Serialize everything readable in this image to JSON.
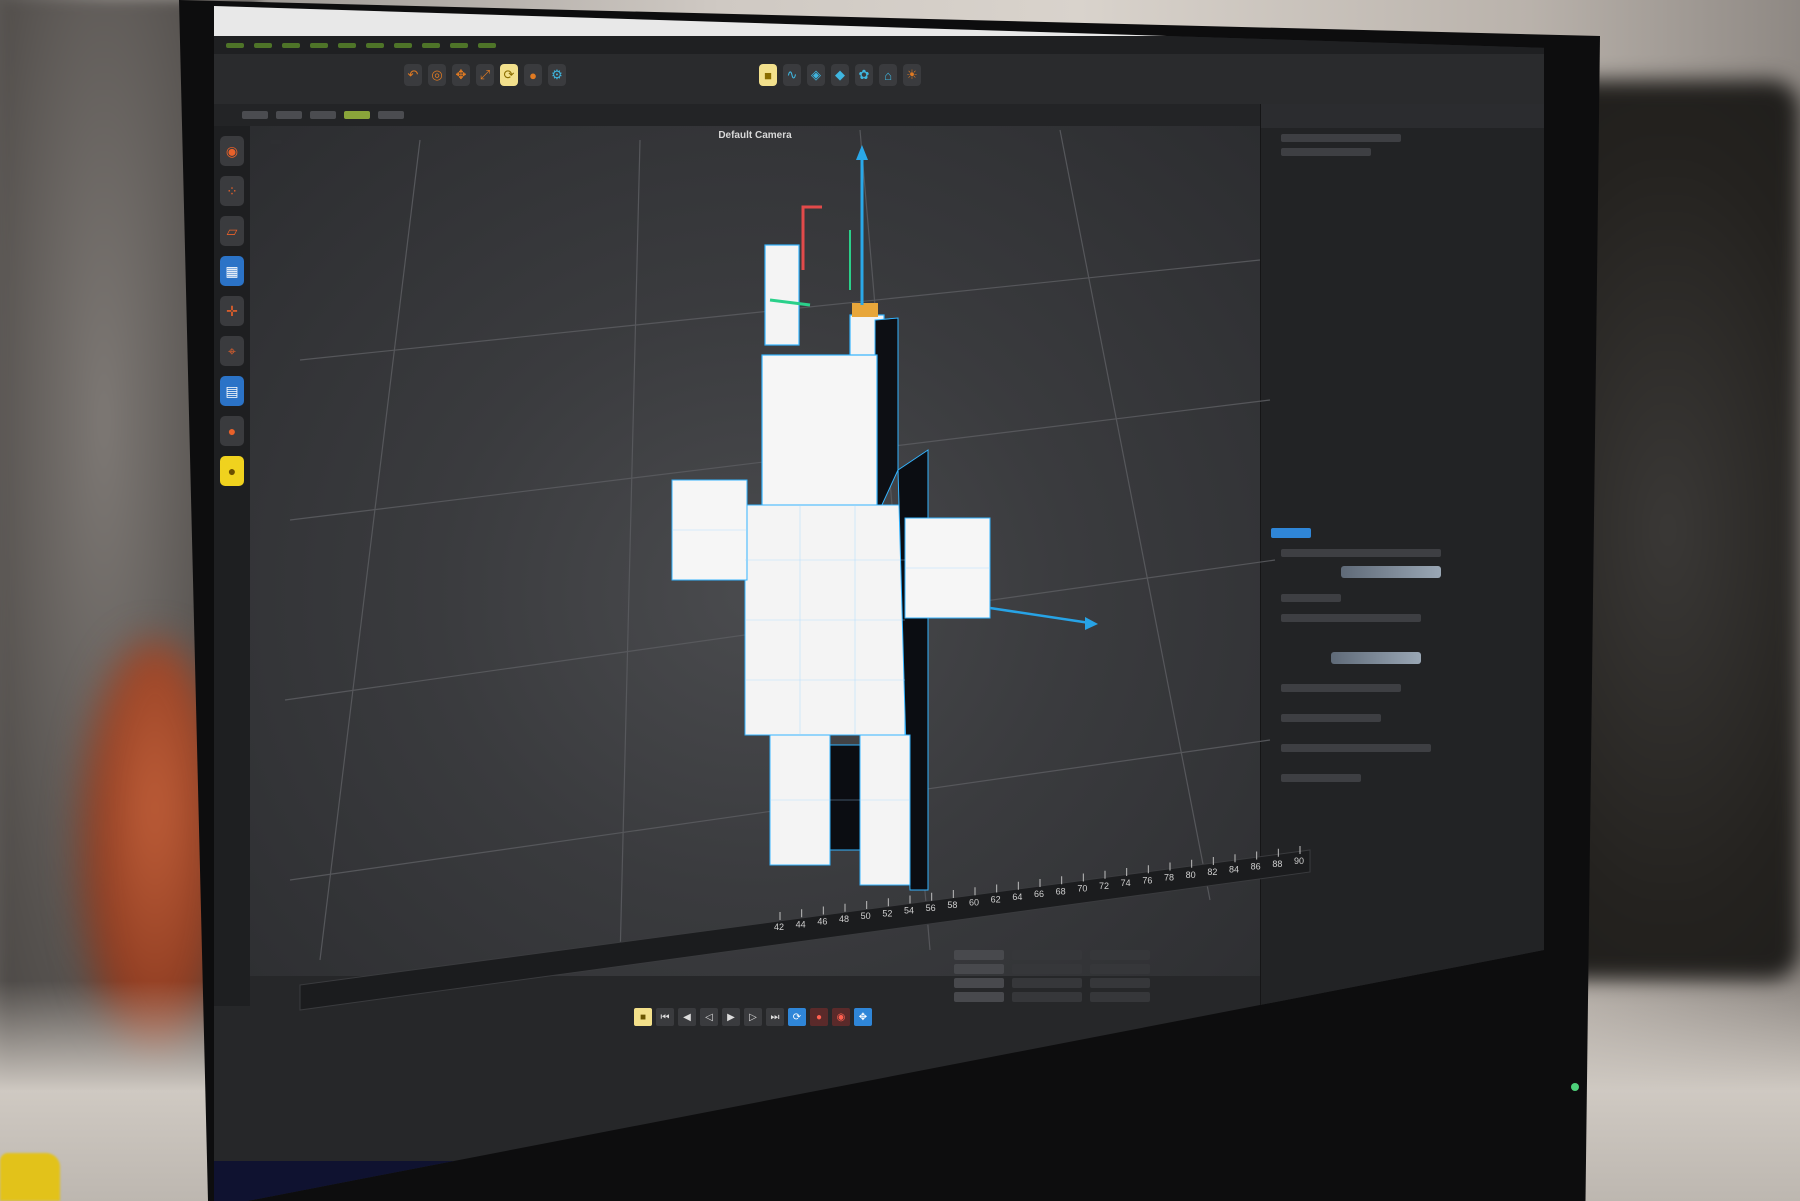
{
  "viewport": {
    "camera_label": "Default Camera"
  },
  "timeline": {
    "frame_numbers": [
      "42",
      "44",
      "46",
      "48",
      "50",
      "52",
      "54",
      "56",
      "58",
      "60",
      "62",
      "64",
      "66",
      "68",
      "70",
      "72",
      "74",
      "76",
      "78",
      "80",
      "82",
      "84",
      "86",
      "88",
      "90"
    ]
  },
  "colors": {
    "axis_x": "#27a3e6",
    "axis_y": "#2aa8e8",
    "axis_z": "#2ad08a",
    "axis_red": "#e24a4a",
    "mesh_wire": "#33b3ff",
    "mesh_face": "#f4f4f4",
    "accent_orange": "#e07a22",
    "accent_yellow": "#f0d21e"
  },
  "icons": {
    "toolbar": [
      "undo-icon",
      "live-select-icon",
      "move-icon",
      "scale-icon",
      "rotate-icon",
      "render-icon",
      "cube-icon",
      "spline-icon",
      "subdivision-icon",
      "deformer-icon",
      "light-icon"
    ],
    "left_tools": [
      "model-mode-icon",
      "points-mode-icon",
      "edges-mode-icon",
      "polygons-mode-icon",
      "axis-mode-icon",
      "snap-icon",
      "workplane-icon"
    ],
    "transport": [
      "go-start-icon",
      "step-back-icon",
      "play-back-icon",
      "play-icon",
      "step-forward-icon",
      "go-end-icon",
      "loop-icon",
      "record-icon",
      "autokey-icon",
      "keyframe-icon"
    ]
  }
}
